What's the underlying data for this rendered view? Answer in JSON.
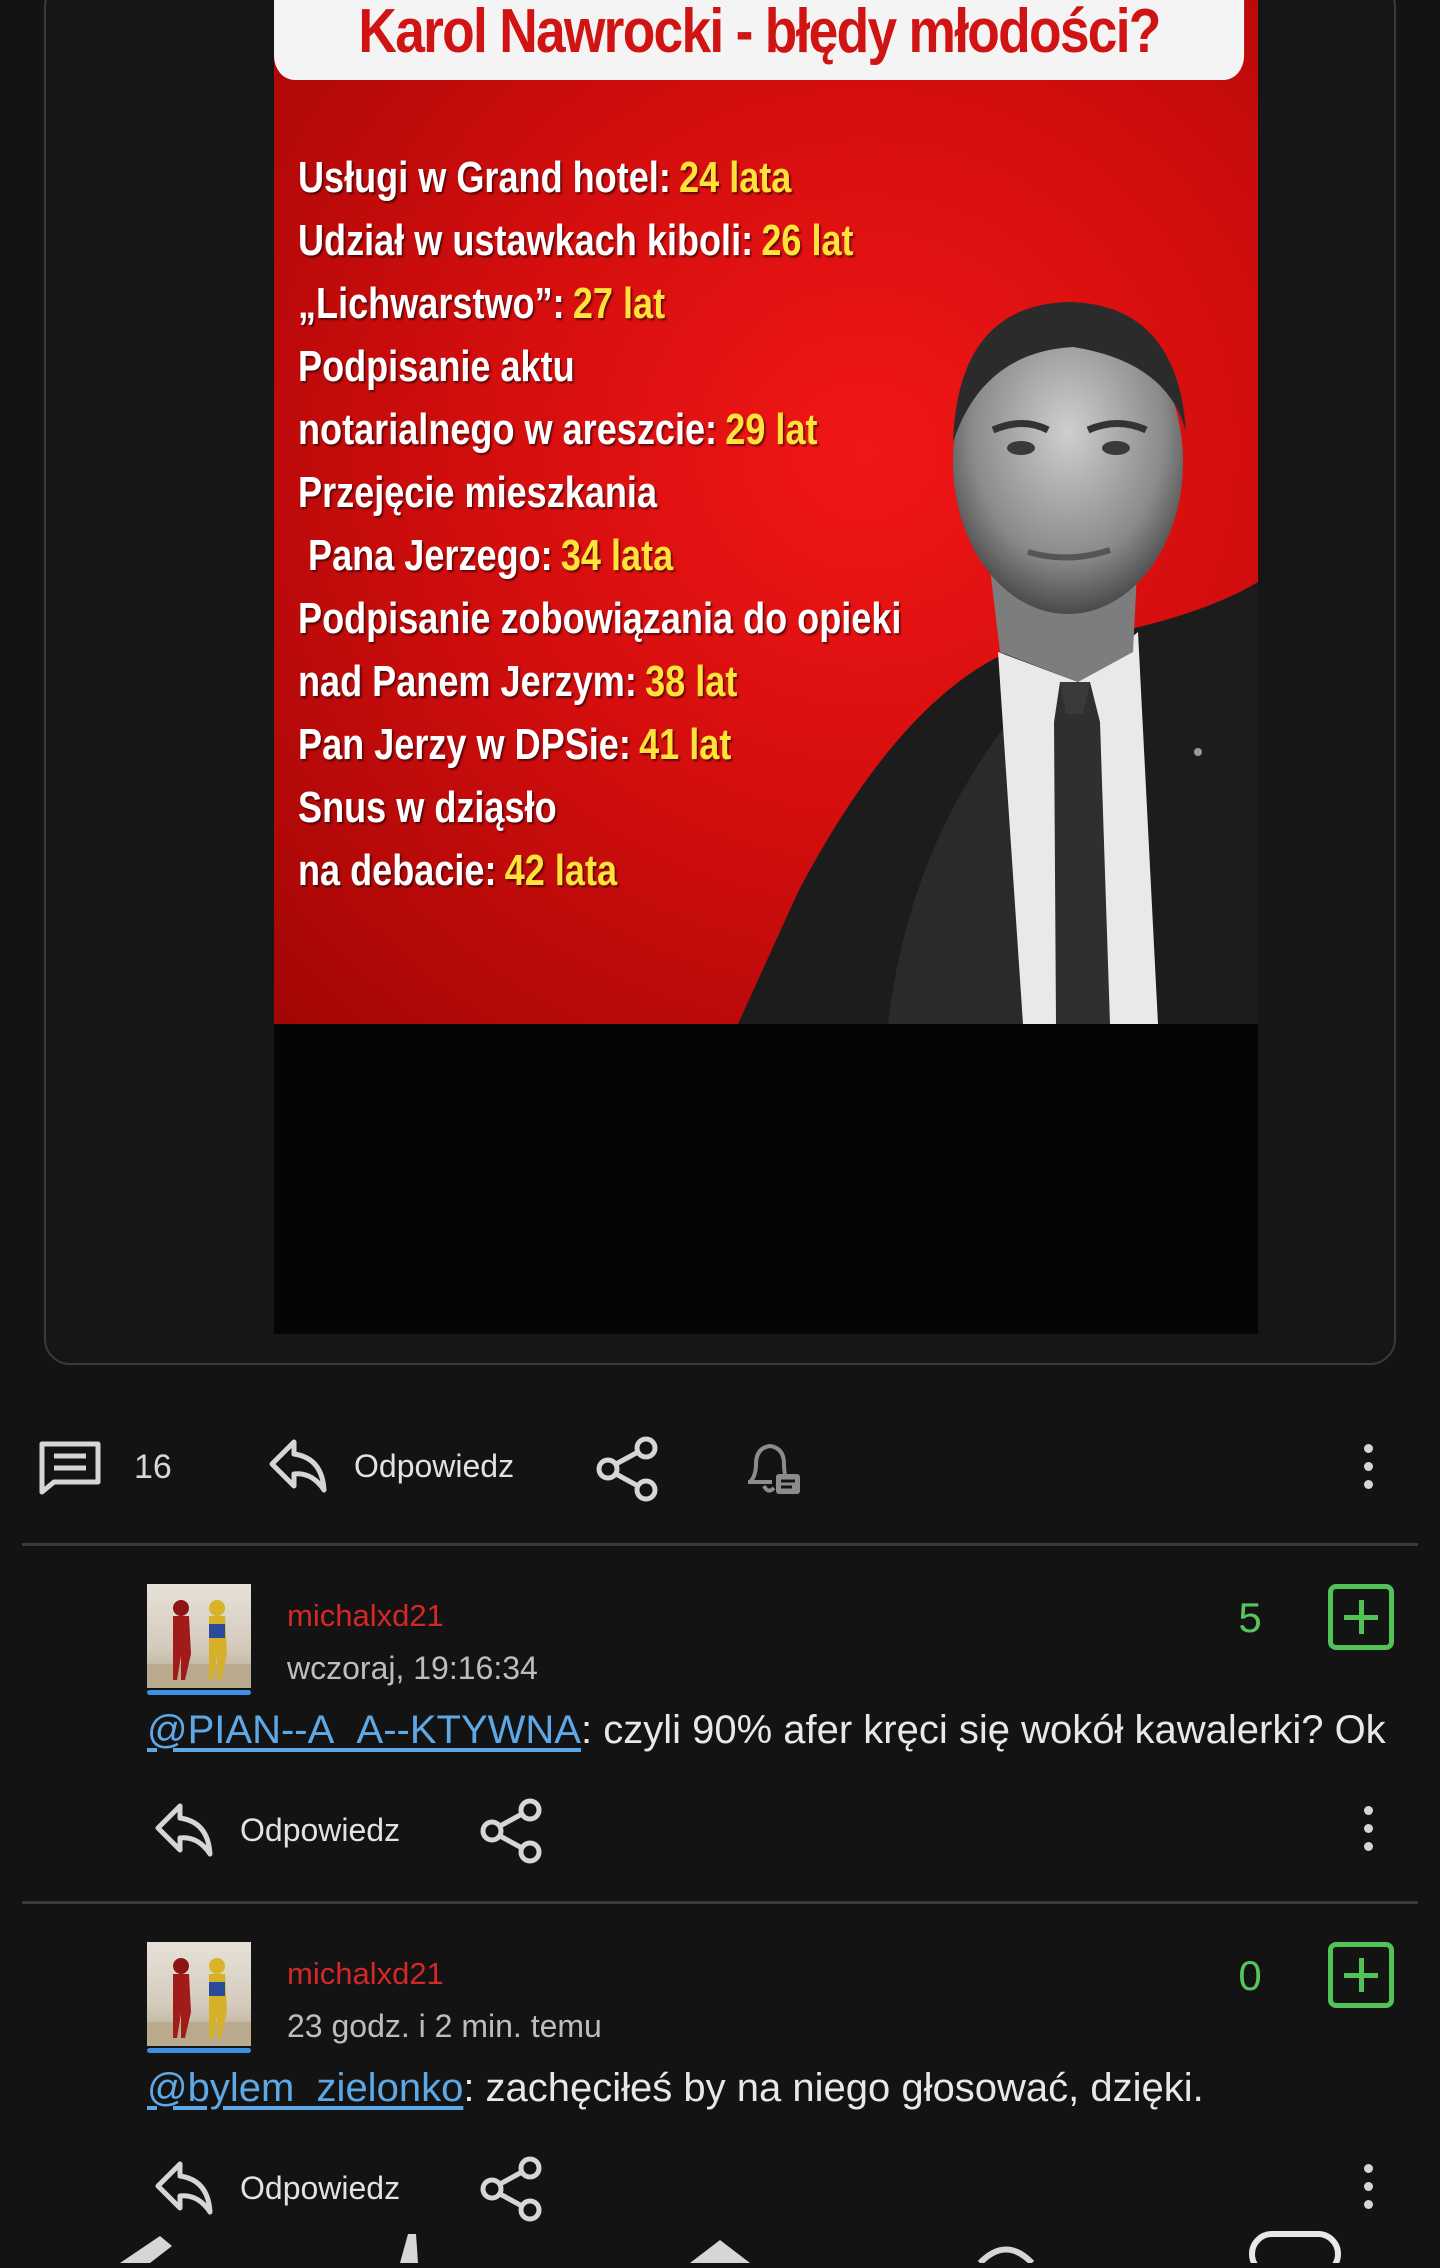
{
  "post": {
    "meme": {
      "title": "Karol Nawrocki - błędy młodości?",
      "items": [
        {
          "text": "Usługi w Grand hotel:",
          "value": "24 lata"
        },
        {
          "text": "Udział w ustawkach kiboli:",
          "value": "26 lat"
        },
        {
          "text": "„Lichwarstwo”:",
          "value": "27 lat"
        },
        {
          "text": "Podpisanie aktu",
          "value": ""
        },
        {
          "text": "notarialnego w areszcie:",
          "value": "29 lat"
        },
        {
          "text": "Przejęcie mieszkania",
          "value": ""
        },
        {
          "text": " Pana Jerzego:",
          "value": "34 lata"
        },
        {
          "text": "Podpisanie zobowiązania do opieki",
          "value": ""
        },
        {
          "text": "nad Panem Jerzym:",
          "value": "38 lat"
        },
        {
          "text": "Pan Jerzy w DPSie:",
          "value": "41 lat"
        },
        {
          "text": "Snus w dziąsło",
          "value": ""
        },
        {
          "text": "na debacie:",
          "value": "42 lata"
        }
      ]
    },
    "actions": {
      "comments_count": "16",
      "reply_label": "Odpowiedz"
    }
  },
  "comments": [
    {
      "username": "michalxd21",
      "timestamp": "wczoraj, 19:16:34",
      "score": "5",
      "mention": "@PIAN--A_A--KTYWNA",
      "text": ": czyli 90% afer kręci się wokół kawalerki? Ok",
      "reply_label": "Odpowiedz"
    },
    {
      "username": "michalxd21",
      "timestamp": "23 godz. i 2 min. temu",
      "score": "0",
      "mention": "@bylem_zielonko",
      "text": ": zachęciłeś by na niego głosować, dzięki.",
      "reply_label": "Odpowiedz"
    }
  ],
  "colors": {
    "background": "#131313",
    "username": "#d22828",
    "score": "#58c45b",
    "mention": "#5fa8e6",
    "meme_red": "#d40e0e",
    "meme_yellow": "#ffe23a"
  },
  "icons": [
    "comments-icon",
    "reply-icon",
    "share-icon",
    "notification-bell-icon",
    "more-options-icon",
    "upvote-plus-icon"
  ]
}
